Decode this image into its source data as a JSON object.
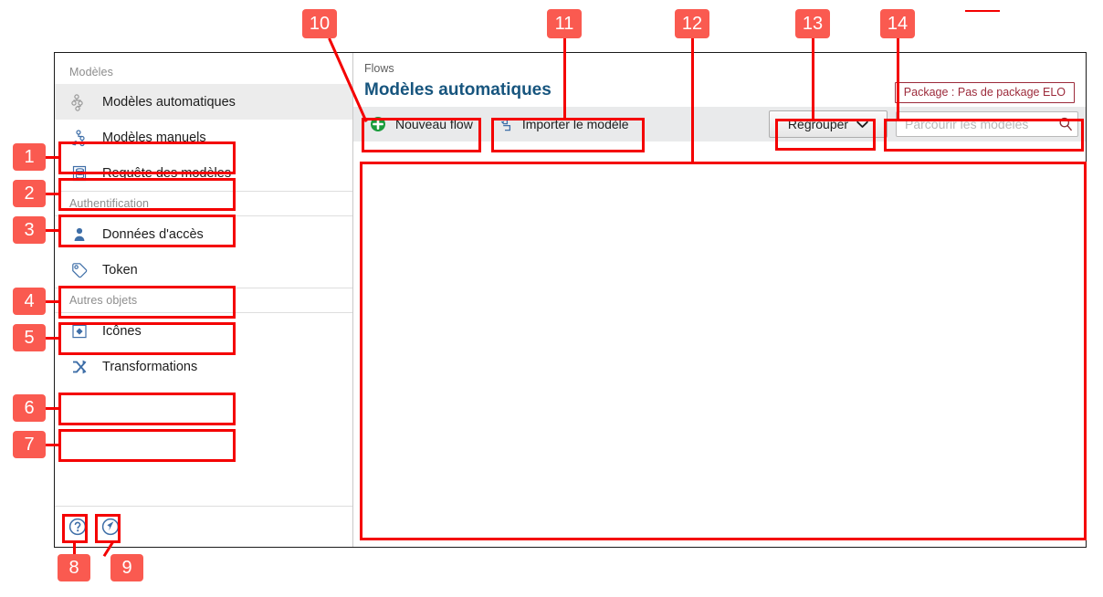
{
  "window": {
    "breadcrumb": "Flows",
    "page_title": "Modèles automatiques",
    "package_badge": "Package : Pas de package ELO"
  },
  "sidebar": {
    "sections": [
      {
        "label": "Modèles",
        "items": [
          {
            "label": "Modèles automatiques",
            "icon": "flow-tree-icon",
            "active": true
          },
          {
            "label": "Modèles manuels",
            "icon": "flow-tree-hand-icon",
            "active": false
          },
          {
            "label": "Requête des modèles",
            "icon": "database-query-icon",
            "active": false
          }
        ]
      },
      {
        "label": "Authentification",
        "items": [
          {
            "label": "Données d'accès",
            "icon": "user-icon",
            "active": false
          },
          {
            "label": "Token",
            "icon": "tag-icon",
            "active": false
          }
        ]
      },
      {
        "label": "Autres objets",
        "items": [
          {
            "label": "Icônes",
            "icon": "image-diamond-icon",
            "active": false
          },
          {
            "label": "Transformations",
            "icon": "shuffle-arrows-icon",
            "active": false
          }
        ]
      }
    ],
    "footer": [
      {
        "icon": "help-question-icon",
        "name": "help-button"
      },
      {
        "icon": "support-pointer-icon",
        "name": "support-button"
      }
    ]
  },
  "toolbar": {
    "new_flow_label": "Nouveau flow",
    "new_flow_icon": "plus-circle-icon",
    "import_label": "Importer le modèle",
    "import_icon": "import-arrow-icon",
    "group_label": "Regrouper",
    "group_chevron_icon": "chevron-down-icon",
    "search_placeholder": "Parcourir les modèles",
    "search_value": "",
    "search_icon": "magnifier-icon"
  },
  "callouts": [
    {
      "number": "1"
    },
    {
      "number": "2"
    },
    {
      "number": "3"
    },
    {
      "number": "4"
    },
    {
      "number": "5"
    },
    {
      "number": "6"
    },
    {
      "number": "7"
    },
    {
      "number": "8"
    },
    {
      "number": "9"
    },
    {
      "number": "10"
    },
    {
      "number": "11"
    },
    {
      "number": "12"
    },
    {
      "number": "13"
    },
    {
      "number": "14"
    }
  ],
  "colors": {
    "accent_red": "#f40000",
    "badge_fill": "#fa5a50",
    "title_blue": "#17557e",
    "package_red": "#9c2a3a",
    "icon_blue": "#3f6fa8",
    "toolbar_bg": "#e9eaeb"
  }
}
